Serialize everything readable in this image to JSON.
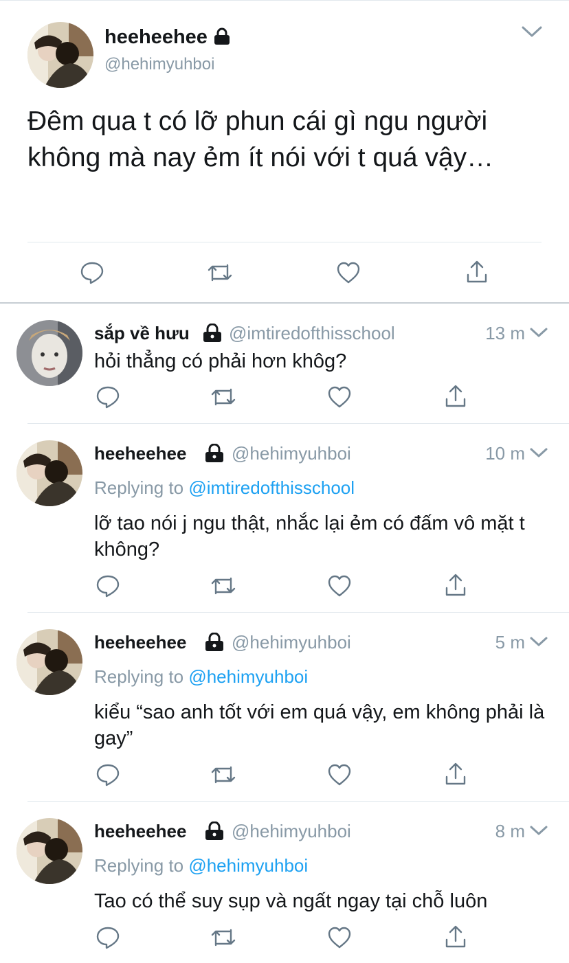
{
  "main_tweet": {
    "avatar": "user-avatar",
    "name": "heeheehee",
    "handle": "@hehimyuhboi",
    "text": "Đêm qua t có lỡ phun cái gì ngu người không mà nay ẻm ít nói với t quá vậy…",
    "icons": [
      "reply-icon",
      "retweet-icon",
      "like-icon",
      "share-icon"
    ]
  },
  "replies": [
    {
      "name": "sắp về hưu",
      "handle": "@imtiredofthisschool",
      "time": "13 m",
      "replying_prefix": "",
      "replying_to": "",
      "text": "hỏi thẳng có phải hơn khôg?"
    },
    {
      "name": "heeheehee",
      "handle": "@hehimyuhboi",
      "time": "10 m",
      "replying_prefix": "Replying to ",
      "replying_to": "@imtiredofthisschool",
      "text": "lỡ tao nói j ngu thật, nhắc lại ẻm có đấm vô mặt t không?"
    },
    {
      "name": "heeheehee",
      "handle": "@hehimyuhboi",
      "time": "5 m",
      "replying_prefix": "Replying to ",
      "replying_to": "@hehimyuhboi",
      "text": "kiểu “sao anh tốt với em quá vậy, em không phải là gay”"
    },
    {
      "name": "heeheehee",
      "handle": "@hehimyuhboi",
      "time": "8 m",
      "replying_prefix": "Replying to ",
      "replying_to": "@hehimyuhboi",
      "text": "Tao có thể suy sụp và ngất ngay tại chỗ luôn"
    }
  ],
  "colors": {
    "text": "#14171a",
    "secondary": "#8899a6",
    "link": "#1da1f2",
    "icon": "#657786",
    "divider": "#e1e8ed"
  }
}
